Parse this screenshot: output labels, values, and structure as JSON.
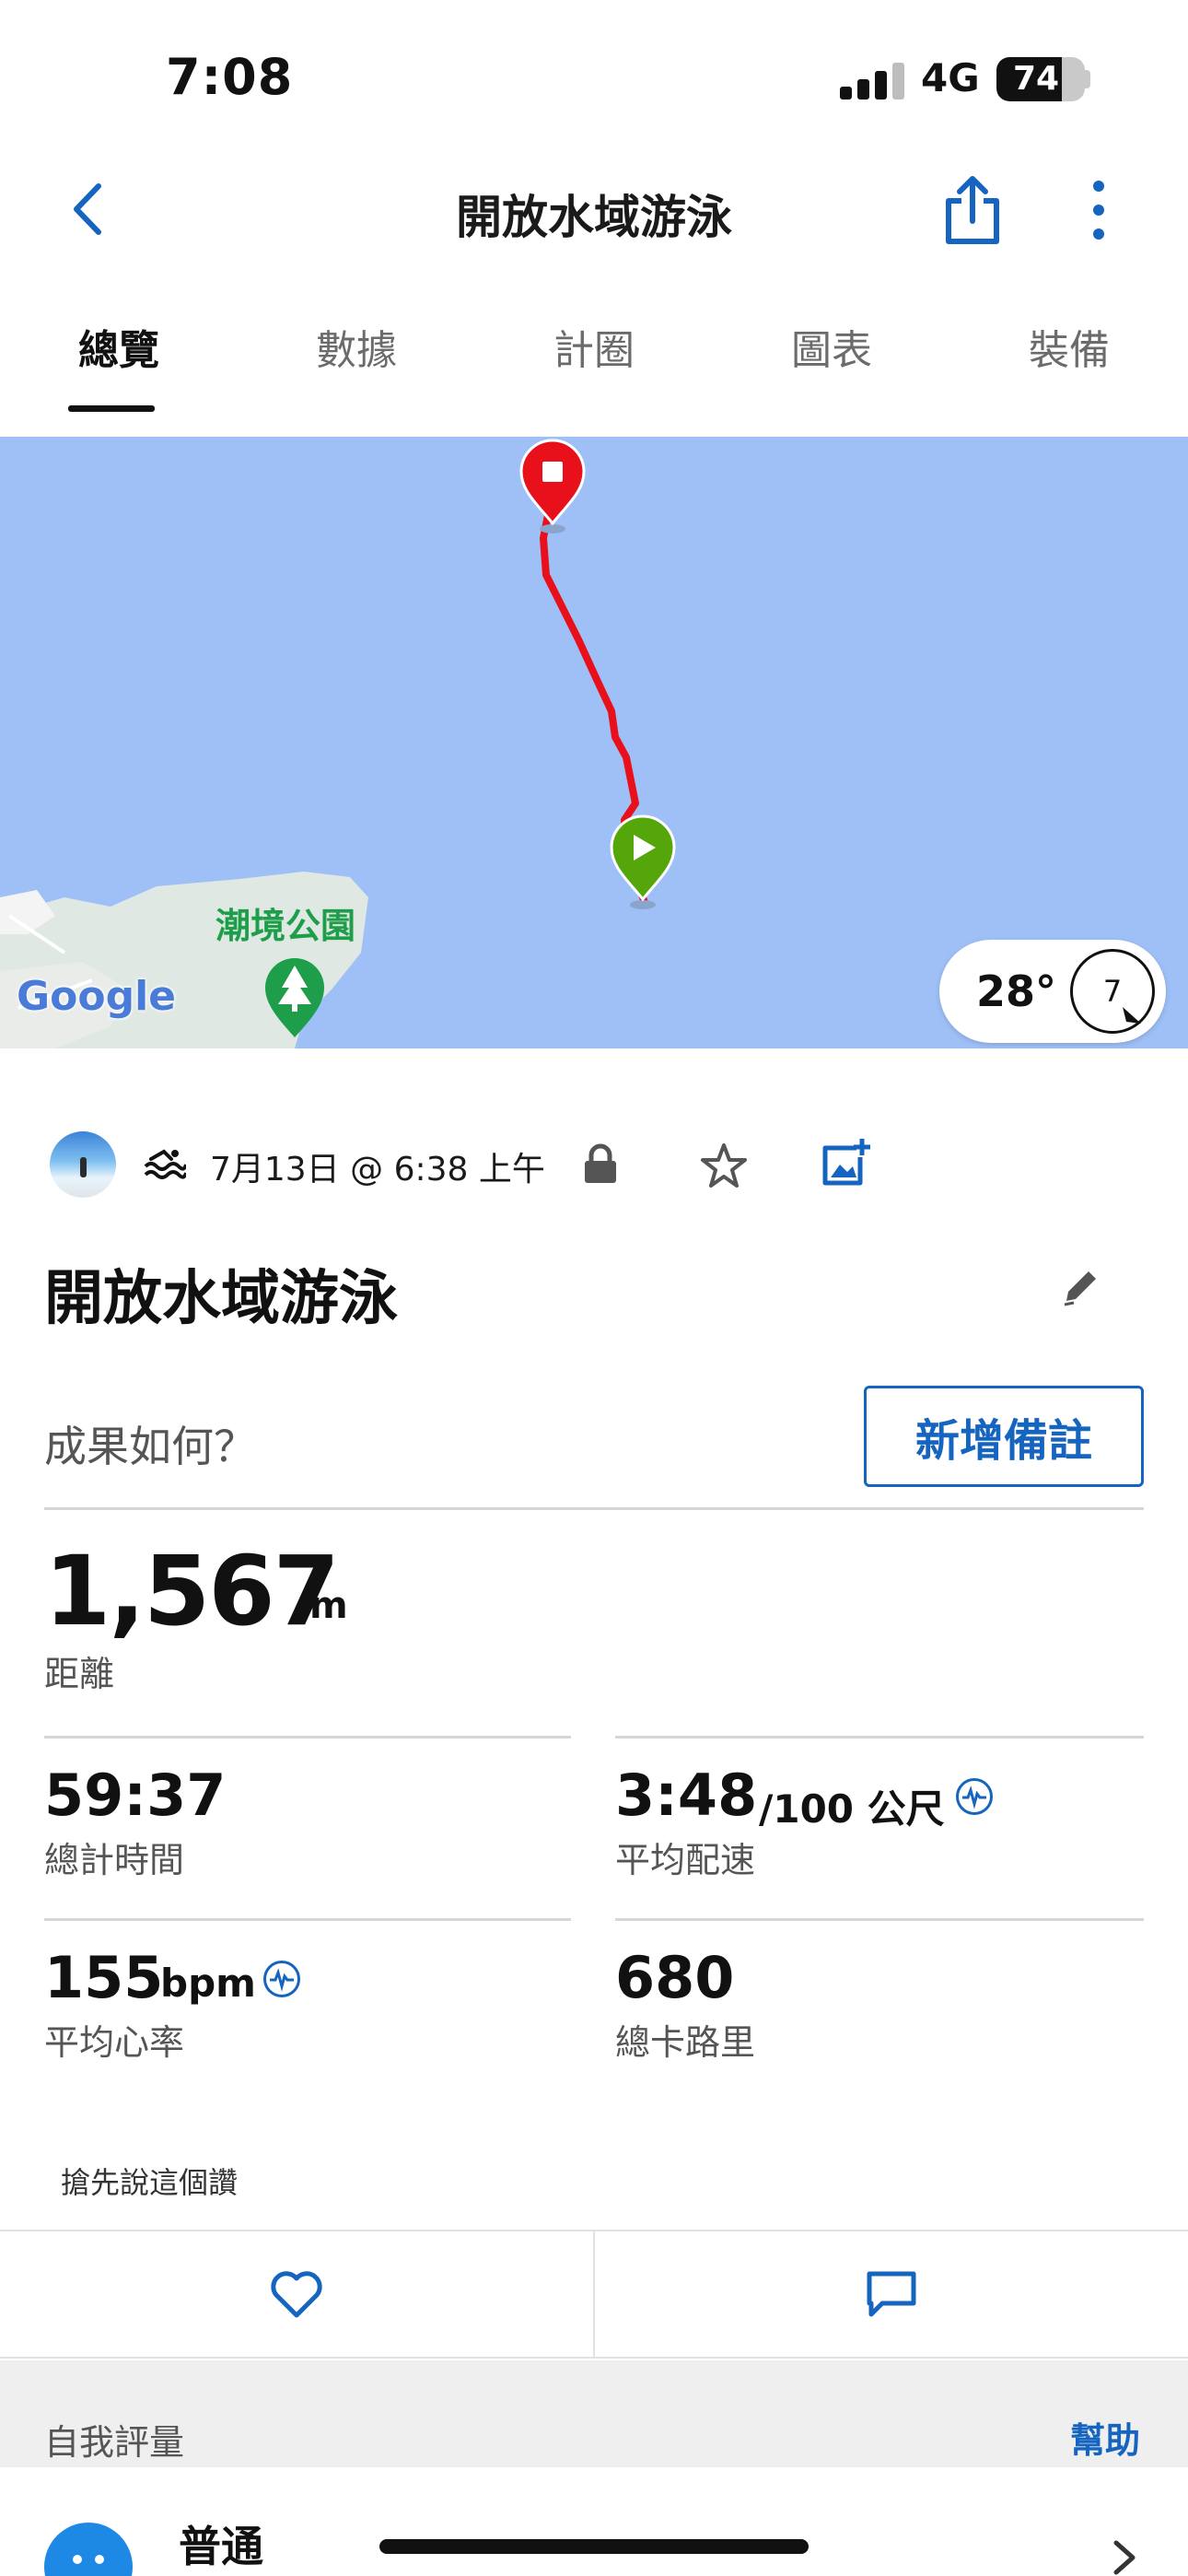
{
  "status_bar": {
    "time": "7:08",
    "network": "4G",
    "battery": "74",
    "battery_level": 0.74
  },
  "header": {
    "title": "開放水域游泳",
    "back_icon": "chevron-left-icon",
    "share_icon": "share-icon",
    "more_icon": "more-vertical-icon"
  },
  "tabs": [
    {
      "label": "總覽",
      "active": true
    },
    {
      "label": "數據",
      "active": false
    },
    {
      "label": "計圈",
      "active": false
    },
    {
      "label": "圖表",
      "active": false
    },
    {
      "label": "裝備",
      "active": false
    }
  ],
  "map": {
    "park_label": "潮境公園",
    "logo": "Google",
    "temperature": "28°",
    "wind_speed": "7",
    "route_color": "#e8111b",
    "water_color": "#9ec0f7",
    "start_marker_color": "#55a60a",
    "end_marker_color": "#e8111b"
  },
  "activity": {
    "date_time": "7月13日 @ 6:38 上午",
    "title": "開放水域游泳",
    "how_label": "成果如何？",
    "add_note_label": "新增備註"
  },
  "stats": {
    "distance": {
      "value": "1,567",
      "unit": "m",
      "label": "距離"
    },
    "total_time": {
      "value": "59:37",
      "label": "總計時間"
    },
    "avg_pace": {
      "value": "3:48",
      "unit": "/100 公尺",
      "label": "平均配速"
    },
    "avg_hr": {
      "value": "155",
      "unit": "bpm",
      "label": "平均心率"
    },
    "calories": {
      "value": "680",
      "label": "總卡路里"
    }
  },
  "social": {
    "kudos_prompt": "搶先說這個讚",
    "like_icon": "heart-icon",
    "comment_icon": "comment-icon"
  },
  "self_eval": {
    "title": "自我評量",
    "help": "幫助",
    "feeling": "普通"
  },
  "colors": {
    "accent": "#1565c0"
  }
}
